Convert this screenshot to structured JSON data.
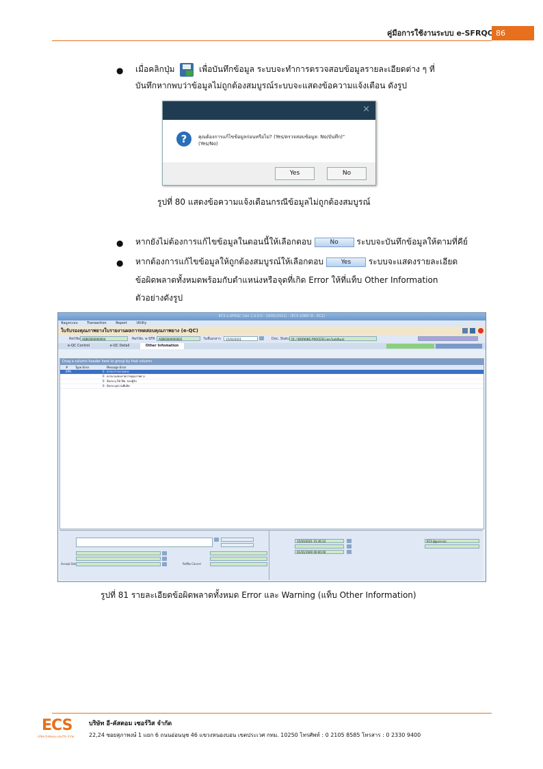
{
  "header": {
    "title": "คู่มือการใช้งานระบบ e-SFRQC",
    "page_number": "86"
  },
  "section1": {
    "bullet_text_a": "เมื่อคลิกปุ่ม",
    "bullet_text_b": "เพื่อบันทึกข้อมูล ระบบจะทำการตรวจสอบข้อมูลรายละเอียดต่าง ๆ ที่",
    "bullet_line2": "บันทึกหากพบว่าข้อมูลไม่ถูกต้องสมบูรณ์ระบบจะแสดงข้อความแจ้งเตือน ดังรูป"
  },
  "dialog": {
    "close_glyph": "×",
    "message_line1": "คุณต้องการแก้ไขข้อมูลก่อนหรือไม่? (Yes/ตรวจสอบข้อมูล: No/บันทึก)\"",
    "message_line2": "(Yes/No)",
    "yes_label": "Yes",
    "no_label": "No"
  },
  "figure80_caption": "รูปที่ 80 แสดงข้อความแจ้งเตือนกรณีข้อมูลไม่ถูกต้องสมบูรณ์",
  "section2": {
    "b1_a": "หากยังไม่ต้องการแก้ไขข้อมูลในตอนนี้ให้เลือกตอบ",
    "b1_btn": "No",
    "b1_b": "ระบบจะบันทึกข้อมูลให้ตามที่คีย์",
    "b2_a": "หากต้องการแก้ไขข้อมูลให้ถูกต้องสมบูรณ์ให้เลือกตอบ",
    "b2_btn": "Yes",
    "b2_b": "ระบบจะแสดงรายละเอียด",
    "b2_line2": "ข้อผิดพลาดทั้งหมดพร้อมกับตำแหน่งหรือจุดที่เกิด Error ให้ที่แท็บ Other Information",
    "b2_line3": "ตัวอย่างดังรูป"
  },
  "app": {
    "title": "ECS e-SFRQC (Ver 1.0.0.0 - 20/05/2021) - (ECS USER ID : ECZ)",
    "menu": [
      "ข้อมูลระบบ",
      "Transaction",
      "Report",
      "Utility"
    ],
    "form_title": "ใบรับรองคุณภาพยางใบรายงานผลการทดสอบคุณภาพยาง (e-QC)",
    "refno_label": "Ref.No",
    "refno_value": "ADBCB00000004",
    "refno_sfr_label": "Ref.No. e-SFR",
    "refno_sfr_value": "ADBCB00000002",
    "date_label": "วันที่เอกสาร",
    "date_value": "15/03/2021",
    "doc_status_label": "Doc. Status",
    "doc_status_value": "01 / WORKING PROCESS (ยกเว้นส่งอีเมล)",
    "tabs": [
      "e-QC Control",
      "e-QC Detail",
      "Other Infomation"
    ],
    "drag_text": "Drag a column header here to group by that column",
    "grid_headers": [
      "#",
      "Type Error",
      "Message Error"
    ],
    "rows": [
      {
        "type": "ERR.",
        "num": "0",
        "msg": "ควรมารายงานของ"
      },
      {
        "type": "",
        "num": "0",
        "msg": "ควรมาแสดงรายการคุณภาพยาง"
      },
      {
        "type": "",
        "num": "0",
        "msg": "ต้องระบุ Str.No. ของผู้รับ"
      },
      {
        "type": "",
        "num": "0",
        "msg": "ต้องระบุสถานที่ผลิต"
      }
    ],
    "accept_label": "Accept Date",
    "refno_cancel_label": "RefNo Cancel",
    "datetime_1": "15/03/2021 15:36:12",
    "datetime_2": "01/01/1900 00:00:00",
    "user_value": "ECS ผู้ดูแลระบบ"
  },
  "figure81_caption": "รูปที่ 81 รายละเอียดข้อผิดพลาดทั้งหมด Error และ Warning (แท็บ Other Information)",
  "footer": {
    "logo_text": "ECS",
    "logo_sub": "บริษัท อี-คัสตอม เซอร์วิส จำกัด",
    "company": "บริษัท อี-คัสตอม เซอร์วิส จำกัด",
    "address": "22,24 ซอยสุภาพงษ์ 1 แยก 6 ถนนอ่อนนุช 46 แขวงหนองบอน เขตประเวศ กทม. 10250 โทรศัพท์ : 0 2105 8585 โทรสาร : 0 2330 9400"
  }
}
